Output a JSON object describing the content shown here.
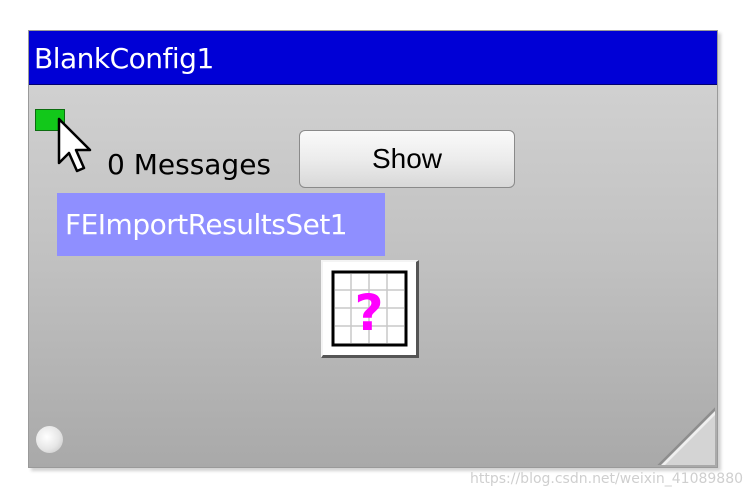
{
  "window": {
    "title": "BlankConfig1"
  },
  "status": {
    "messages_text": "0 Messages",
    "led_color": "#12c81a"
  },
  "toolbar": {
    "show_label": "Show"
  },
  "node": {
    "label": "FEImportResultsSet1",
    "highlight_color": "#8f8fff"
  },
  "icons": {
    "help": "grid-question-mark-icon",
    "cursor": "mouse-pointer-icon",
    "indicator": "round-indicator-icon",
    "grip": "resize-grip-icon"
  },
  "colors": {
    "title_bar": "#0000d6",
    "question_mark": "#ff00ff"
  },
  "watermark": "https://blog.csdn.net/weixin_41089880"
}
